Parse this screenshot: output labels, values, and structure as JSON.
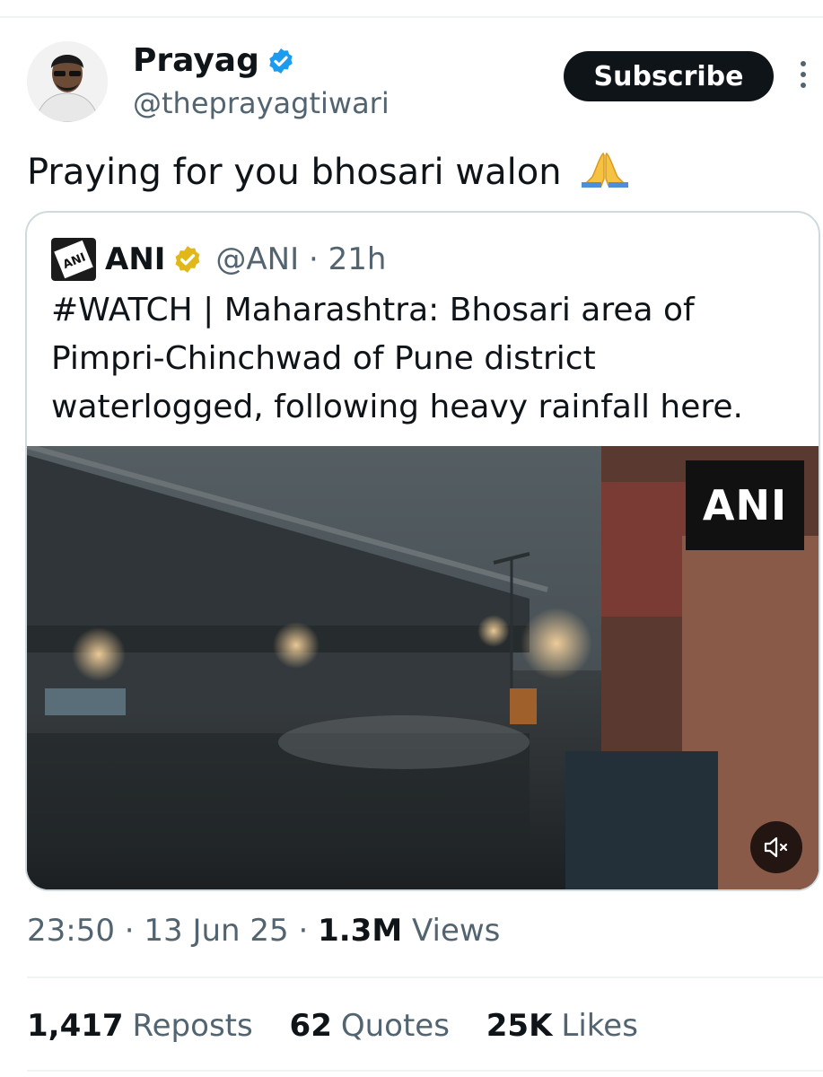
{
  "author": {
    "name": "Prayag",
    "handle": "@theprayagtiwari",
    "subscribe_label": "Subscribe"
  },
  "tweet": {
    "text": "Praying for you bhosari walon",
    "emoji": "folded-hands"
  },
  "quoted": {
    "name": "ANI",
    "handle_time": "@ANI · 21h",
    "text": "#WATCH | Maharashtra: Bhosari area of Pimpri-Chinchwad of Pune district waterlogged, following heavy rainfall here.",
    "video_watermark": "ANI"
  },
  "meta": {
    "time_date": "23:50 · 13 Jun 25 · ",
    "views_count": "1.3M",
    "views_label": "Views"
  },
  "stats": {
    "reposts_count": "1,417",
    "reposts_label": "Reposts",
    "quotes_count": "62",
    "quotes_label": "Quotes",
    "likes_count": "25K",
    "likes_label": "Likes"
  },
  "colors": {
    "text": "#0f1419",
    "secondary": "#536471",
    "verified_blue": "#1d9bf0",
    "verified_gold": "#e2b719"
  }
}
